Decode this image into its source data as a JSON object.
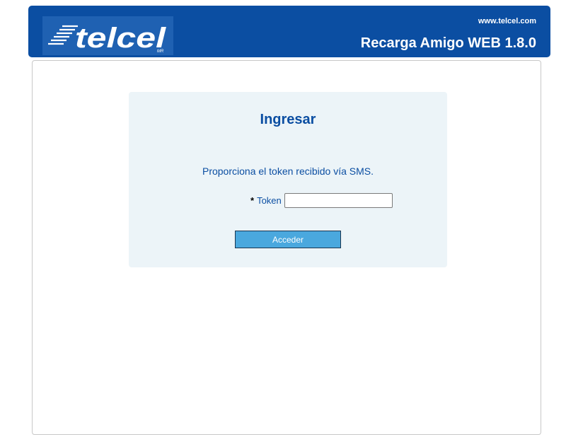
{
  "header": {
    "logo_text": "telcel",
    "logo_mark": "MR",
    "link": "www.telcel.com",
    "title": "Recarga Amigo WEB 1.8.0"
  },
  "login": {
    "title": "Ingresar",
    "instruction": "Proporciona el token recibido vía SMS.",
    "required_mark": "*",
    "token_label": "Token",
    "token_value": "",
    "submit_label": "Acceder"
  },
  "colors": {
    "header_blue": "#0b4ea2",
    "panel_bg": "#ecf4f8",
    "button_blue": "#4aa8de"
  }
}
